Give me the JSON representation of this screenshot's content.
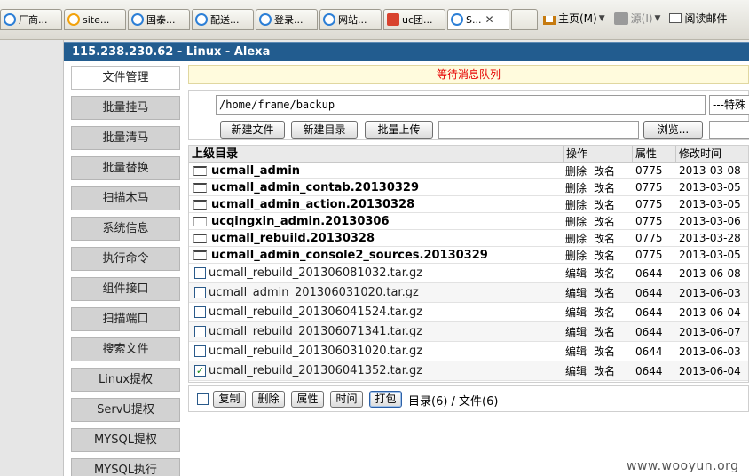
{
  "browser": {
    "tabs": [
      {
        "label": "厂商...",
        "icon": "ie"
      },
      {
        "label": "site...",
        "icon": "baidu"
      },
      {
        "label": "国泰...",
        "icon": "ie"
      },
      {
        "label": "配送...",
        "icon": "ie"
      },
      {
        "label": "登录...",
        "icon": "ie"
      },
      {
        "label": "网站...",
        "icon": "ie"
      },
      {
        "label": "uc团...",
        "icon": "red"
      },
      {
        "label": "S...",
        "icon": "ie",
        "active": true,
        "close": "✕"
      }
    ],
    "home_label": "主页(M)",
    "feeds_label": "源(I)",
    "reading_label": "阅读邮件"
  },
  "app": {
    "title": "115.238.230.62 - Linux - Alexa"
  },
  "sidebar": {
    "items": [
      {
        "label": "文件管理",
        "active": true
      },
      {
        "label": "批量挂马"
      },
      {
        "label": "批量清马"
      },
      {
        "label": "批量替换"
      },
      {
        "label": "扫描木马"
      },
      {
        "label": "系统信息"
      },
      {
        "label": "执行命令"
      },
      {
        "label": "组件接口"
      },
      {
        "label": "扫描端口"
      },
      {
        "label": "搜索文件"
      },
      {
        "label": "Linux提权"
      },
      {
        "label": "ServU提权"
      },
      {
        "label": "MYSQL提权"
      },
      {
        "label": "MYSQL执行"
      }
    ]
  },
  "main": {
    "message": "等待消息队列",
    "path_value": "/home/frame/backup",
    "special_select": "---特殊",
    "buttons": {
      "new_file": "新建文件",
      "new_dir": "新建目录",
      "batch_upload": "批量上传",
      "browse": "浏览..."
    },
    "table": {
      "headers": {
        "name": "上级目录",
        "ops": "操作",
        "attr": "属性",
        "time": "修改时间"
      },
      "dirs": [
        {
          "name": "ucmall_admin",
          "ops": [
            "删除",
            "改名"
          ],
          "attr": "0775",
          "time": "2013-03-08"
        },
        {
          "name": "ucmall_admin_contab.20130329",
          "ops": [
            "删除",
            "改名"
          ],
          "attr": "0775",
          "time": "2013-03-05"
        },
        {
          "name": "ucmall_admin_action.20130328",
          "ops": [
            "删除",
            "改名"
          ],
          "attr": "0775",
          "time": "2013-03-05"
        },
        {
          "name": "ucqingxin_admin.20130306",
          "ops": [
            "删除",
            "改名"
          ],
          "attr": "0775",
          "time": "2013-03-06"
        },
        {
          "name": "ucmall_rebuild.20130328",
          "ops": [
            "删除",
            "改名"
          ],
          "attr": "0775",
          "time": "2013-03-28"
        },
        {
          "name": "ucmall_admin_console2_sources.20130329",
          "ops": [
            "删除",
            "改名"
          ],
          "attr": "0775",
          "time": "2013-03-05"
        }
      ],
      "files": [
        {
          "name": "ucmall_rebuild_201306081032.tar.gz",
          "ops": [
            "编辑",
            "改名"
          ],
          "attr": "0644",
          "time": "2013-06-08",
          "checked": false
        },
        {
          "name": "ucmall_admin_201306031020.tar.gz",
          "ops": [
            "编辑",
            "改名"
          ],
          "attr": "0644",
          "time": "2013-06-03",
          "checked": false
        },
        {
          "name": "ucmall_rebuild_201306041524.tar.gz",
          "ops": [
            "编辑",
            "改名"
          ],
          "attr": "0644",
          "time": "2013-06-04",
          "checked": false
        },
        {
          "name": "ucmall_rebuild_201306071341.tar.gz",
          "ops": [
            "编辑",
            "改名"
          ],
          "attr": "0644",
          "time": "2013-06-07",
          "checked": false
        },
        {
          "name": "ucmall_rebuild_201306031020.tar.gz",
          "ops": [
            "编辑",
            "改名"
          ],
          "attr": "0644",
          "time": "2013-06-03",
          "checked": false
        },
        {
          "name": "ucmall_rebuild_201306041352.tar.gz",
          "ops": [
            "编辑",
            "改名"
          ],
          "attr": "0644",
          "time": "2013-06-04",
          "checked": true
        }
      ]
    },
    "bottom": {
      "copy": "复制",
      "delete": "删除",
      "attr": "属性",
      "time": "时间",
      "pack": "打包",
      "count": "目录(6) / 文件(6)"
    }
  },
  "watermark": "www.wooyun.org"
}
